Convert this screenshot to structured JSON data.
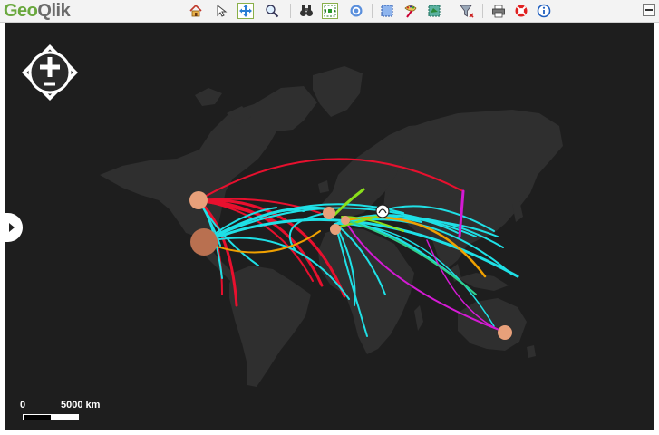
{
  "app": {
    "logo_part1": "Geo",
    "logo_part2": "Qlik"
  },
  "toolbar": {
    "buttons": [
      {
        "icon": "home-icon"
      },
      {
        "icon": "pointer-icon"
      },
      {
        "icon": "pan-icon",
        "active": true
      },
      {
        "icon": "zoom-icon"
      },
      {
        "icon": "binoculars-icon"
      },
      {
        "icon": "zoom-extent-icon",
        "active": true
      },
      {
        "icon": "target-icon"
      },
      {
        "icon": "rectangle-select-icon"
      },
      {
        "icon": "paint-icon"
      },
      {
        "icon": "lasso-select-icon"
      },
      {
        "icon": "filter-icon"
      },
      {
        "icon": "print-icon"
      },
      {
        "icon": "help-lifebuoy-icon"
      },
      {
        "icon": "info-icon"
      }
    ]
  },
  "map": {
    "background_color": "#1e1e1e",
    "land_color": "#2f2f2f",
    "flow_colors": {
      "cyan": "#1fe0e6",
      "red": "#e8102e",
      "magenta": "#d41ad4",
      "orange": "#f0a000",
      "green": "#8adf1a"
    },
    "node_color": "#e8a07a"
  },
  "scalebar": {
    "label_start": "0",
    "label_end": "5000 km"
  }
}
